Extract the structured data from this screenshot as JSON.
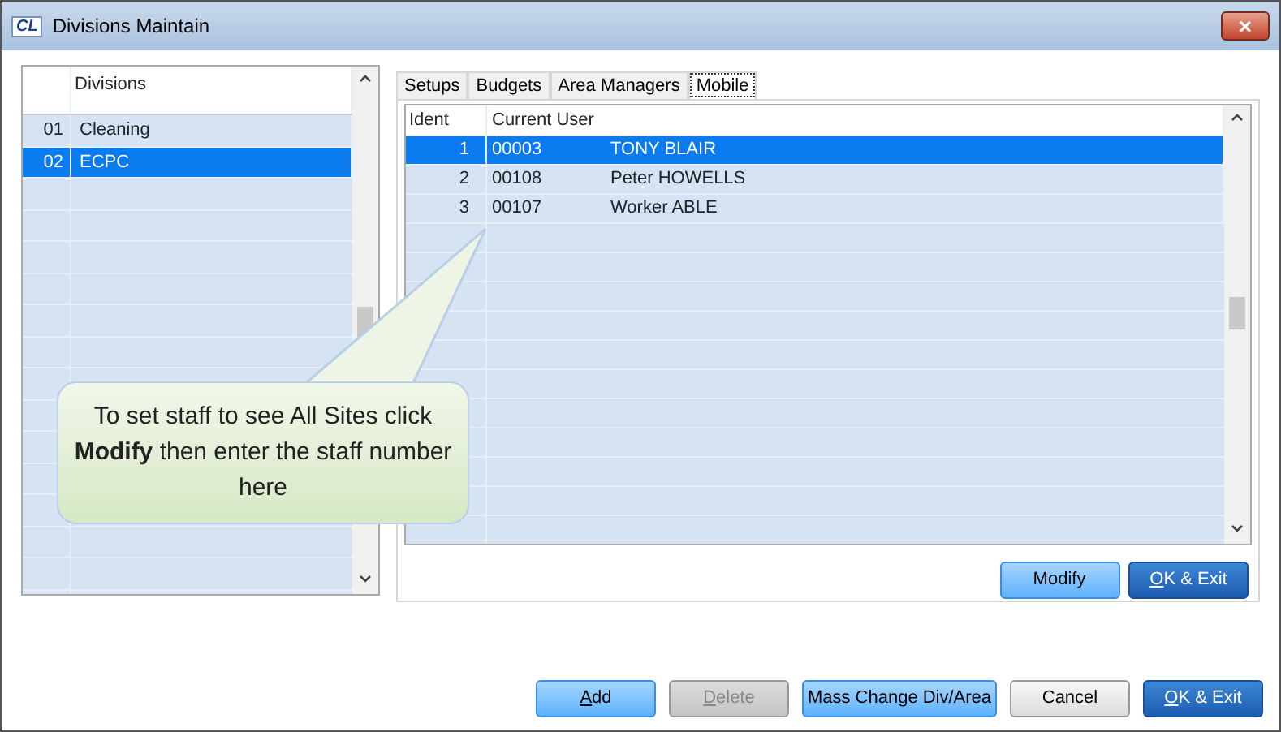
{
  "window": {
    "title": "Divisions Maintain",
    "logo": "CL",
    "close": "×"
  },
  "divisions": {
    "header": "Divisions",
    "rows": [
      {
        "code": "01",
        "name": "Cleaning",
        "selected": false
      },
      {
        "code": "02",
        "name": "ECPC",
        "selected": true
      }
    ]
  },
  "tabs": [
    {
      "label": "Setups",
      "selected": false
    },
    {
      "label": "Budgets",
      "selected": false
    },
    {
      "label": "Area Managers",
      "selected": false
    },
    {
      "label": "Mobile",
      "selected": true
    }
  ],
  "mobile": {
    "columns": [
      "Ident",
      "Current User"
    ],
    "rows": [
      {
        "ident": "1",
        "code": "00003",
        "name": "TONY BLAIR",
        "selected": true
      },
      {
        "ident": "2",
        "code": "00108",
        "name": "Peter HOWELLS",
        "selected": false
      },
      {
        "ident": "3",
        "code": "00107",
        "name": "Worker ABLE",
        "selected": false
      }
    ],
    "buttons": [
      {
        "label": "Modify",
        "kind": "light",
        "mnemonic": false,
        "disabled": false
      },
      {
        "label": "OK & Exit",
        "kind": "dark",
        "mnemonic": true,
        "disabled": false
      }
    ]
  },
  "callout": "To set staff to see All Sites click **Modify** then enter the staff number here",
  "buttons": [
    {
      "label": "Add",
      "kind": "light",
      "mnemonic": true,
      "disabled": false
    },
    {
      "label": "Delete",
      "kind": "light",
      "mnemonic": true,
      "disabled": true
    },
    {
      "label": "Mass Change Div/Area",
      "kind": "light",
      "mnemonic": false,
      "disabled": false
    },
    {
      "label": "Cancel",
      "kind": "plain",
      "mnemonic": false,
      "disabled": false
    },
    {
      "label": "OK & Exit",
      "kind": "dark",
      "mnemonic": true,
      "disabled": false
    }
  ]
}
